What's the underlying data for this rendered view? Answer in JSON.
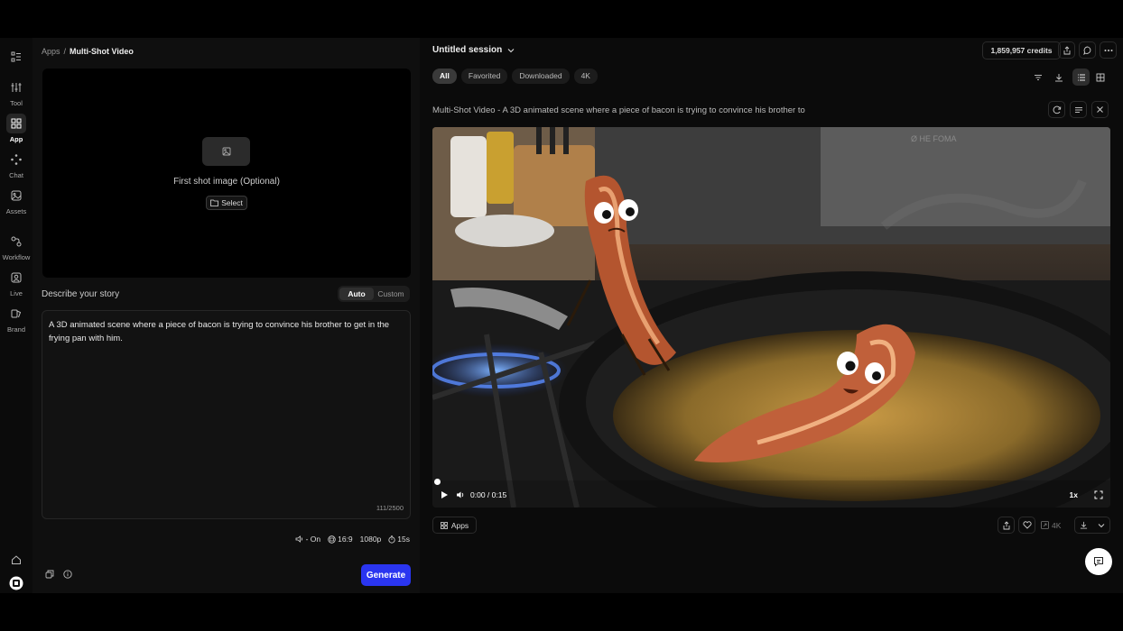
{
  "rail": {
    "items": [
      {
        "label": "Tool",
        "icon": "sliders-icon"
      },
      {
        "label": "App",
        "icon": "grid-icon"
      },
      {
        "label": "Chat",
        "icon": "chat-nodes-icon"
      },
      {
        "label": "Assets",
        "icon": "image-icon"
      },
      {
        "label": "Workflow",
        "icon": "workflow-icon"
      },
      {
        "label": "Live",
        "icon": "live-icon"
      },
      {
        "label": "Brand",
        "icon": "brand-icon"
      }
    ],
    "active": "App"
  },
  "breadcrumb": {
    "root": "Apps",
    "sep": "/",
    "current": "Multi-Shot Video"
  },
  "upload": {
    "label": "First shot image (Optional)",
    "select_label": "Select"
  },
  "story": {
    "heading": "Describe your story",
    "mode_auto": "Auto",
    "mode_custom": "Custom",
    "text": "A 3D animated scene where a piece of bacon is trying to convince his brother to get in the frying pan with him.",
    "count": "111/2500"
  },
  "options": {
    "audio": "- On",
    "ratio": "16:9",
    "resolution": "1080p",
    "duration": "15s"
  },
  "generate_label": "Generate",
  "session": {
    "title": "Untitled session",
    "credits": "1,859,957 credits"
  },
  "filters": [
    "All",
    "Favorited",
    "Downloaded",
    "4K"
  ],
  "video": {
    "title": "Multi-Shot Video - A 3D animated scene where a piece of bacon is trying to convince his brother to",
    "time": "0:00 / 0:15",
    "speed": "1x",
    "progress": 0,
    "watermark": "Ø HE FOMA",
    "upscale_label": "4K"
  },
  "apps_button": "Apps",
  "colors": {
    "accent": "#2a35f0",
    "bg": "#0b0b0b",
    "panel": "#0f0f0f"
  }
}
